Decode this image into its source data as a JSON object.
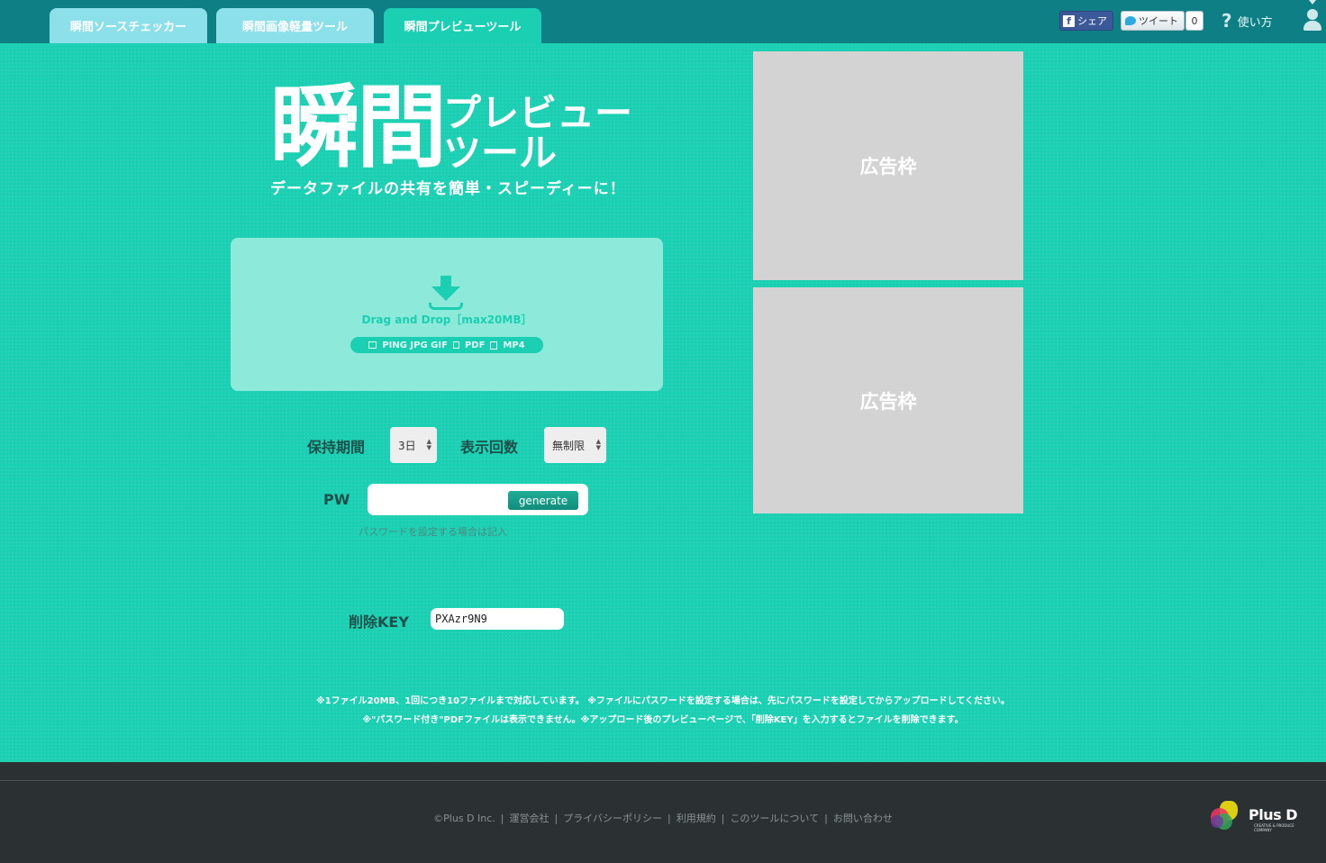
{
  "header": {
    "tabs": [
      {
        "label": "瞬間ソースチェッカー",
        "active": false
      },
      {
        "label": "瞬間画像軽量ツール",
        "active": false
      },
      {
        "label": "瞬間プレビューツール",
        "active": true
      }
    ],
    "share_label": "シェア",
    "tweet_label": "ツイート",
    "tweet_count": "0",
    "help_label": "使い方"
  },
  "hero": {
    "logo_kanji": "瞬間",
    "logo_kana_line1": "プレビュー",
    "logo_kana_line2": "ツール",
    "tagline": "データファイルの共有を簡単・スピーディーに！"
  },
  "dropzone": {
    "text": "Drag and Drop［max20MB］",
    "formats_image": "PING JPG GIF",
    "format_pdf": "PDF",
    "format_video": "MP4"
  },
  "form": {
    "retention_label": "保持期間",
    "retention_value": "3日",
    "views_label": "表示回数",
    "views_value": "無制限",
    "pw_label": "PW",
    "pw_value": "",
    "generate_label": "generate",
    "pw_hint": "パスワードを設定する場合は記入",
    "delete_key_label": "削除KEY",
    "delete_key_value": "PXAzr9N9"
  },
  "ads": [
    "広告枠",
    "広告枠"
  ],
  "notes": {
    "line1": "※1ファイル20MB、1回につき10ファイルまで対応しています。 ※ファイルにパスワードを設定する場合は、先にパスワードを設定してからアップロードしてください。",
    "line2": "※\"パスワード付き\"PDFファイルは表示できません。※アップロード後のプレビューページで、「削除KEY」を入力するとファイルを削除できます。"
  },
  "footer": {
    "links": [
      "©Plus D Inc.",
      "|",
      "運営会社",
      "|",
      "プライバシーポリシー",
      "|",
      "利用規約",
      "|",
      "このツールについて",
      "|",
      "お問い合わせ"
    ],
    "brand": "Plus D",
    "brand_sub": "CREATIVE & PRODUCE COMPANY"
  },
  "colors": {
    "background": "#1acfb2",
    "header": "#0e7f84",
    "footer": "#2b3132",
    "ad": "#d3d3d3"
  }
}
